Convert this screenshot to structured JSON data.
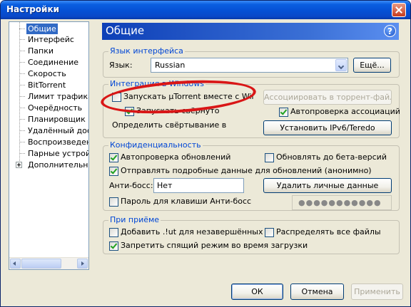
{
  "window": {
    "title": "Настройки"
  },
  "tree": {
    "items": [
      {
        "label": "Общие"
      },
      {
        "label": "Интерфейс"
      },
      {
        "label": "Папки"
      },
      {
        "label": "Соединение"
      },
      {
        "label": "Скорость"
      },
      {
        "label": "BitTorrent"
      },
      {
        "label": "Лимит трафика"
      },
      {
        "label": "Очерёдность"
      },
      {
        "label": "Планировщик"
      },
      {
        "label": "Удалённый дост"
      },
      {
        "label": "Воспроизведение"
      },
      {
        "label": "Парные устройст"
      },
      {
        "label": "Дополнительно"
      }
    ]
  },
  "panel": {
    "title": "Общие",
    "help_icon": "?"
  },
  "lang_group": {
    "legend": "Язык интерфейса",
    "label": "Язык:",
    "value": "Russian",
    "more_button": "Ещё..."
  },
  "windows_group": {
    "legend": "Интеграция в Windows",
    "start_with_windows": "Запускать µTorrent вместе с Windows",
    "start_minimized": "Запускать свёрнуто",
    "detect_minimize": "Определить свёртывание в",
    "associate_button": "Ассоциировать в торрент-файлами",
    "auto_check_assoc": "Автопроверка ассоциаций",
    "ipv6_button": "Установить IPv6/Teredo"
  },
  "privacy_group": {
    "legend": "Конфиденциальность",
    "auto_update": "Автопроверка обновлений",
    "beta_update": "Обновлять до бета-версий",
    "send_data": "Отправлять подробные данные для обновлений (анонимно)",
    "boss_label": "Анти-босс:",
    "boss_value": "Нет",
    "delete_data_button": "Удалить личные данные",
    "boss_password": "Пароль для клавиши Анти-босс",
    "password_mask": "●●●●●●●●●●●"
  },
  "download_group": {
    "legend": "При приёме",
    "add_ut": "Добавить .!ut для незавершённых",
    "allocate_all": "Распределять все файлы",
    "prevent_sleep": "Запретить спящий режим во время загрузки"
  },
  "buttons": {
    "ok": "ОК",
    "cancel": "Отмена",
    "apply": "Применить"
  },
  "colors": {
    "accent": "#0046d5",
    "annotation": "#d91616",
    "header": "#0d3fb7"
  },
  "checkbox_states": {
    "start_with_windows": false,
    "start_minimized": true,
    "auto_check_assoc": true,
    "auto_update": true,
    "beta_update": false,
    "send_data": true,
    "boss_password": false,
    "add_ut": false,
    "allocate_all": false,
    "prevent_sleep": true
  }
}
